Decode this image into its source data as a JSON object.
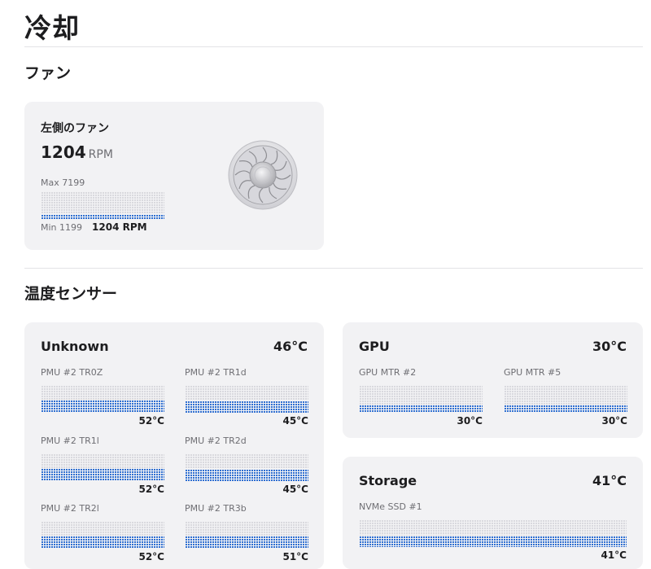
{
  "page": {
    "title": "冷却"
  },
  "fans_section": {
    "title": "ファン",
    "fan": {
      "name": "左側のファン",
      "rpm": "1204",
      "unit": "RPM",
      "max_label": "Max 7199",
      "min_label": "Min 1199",
      "current_label": "1204 RPM",
      "icon": "fan-icon"
    }
  },
  "sensors_section": {
    "title": "温度センサー",
    "groups": {
      "unknown": {
        "title": "Unknown",
        "temp": "46°C",
        "sensors": [
          {
            "label": "PMU #2 TR0Z",
            "value": "52°C",
            "fill_pct": 52
          },
          {
            "label": "PMU #2 TR1d",
            "value": "45°C",
            "fill_pct": 45
          },
          {
            "label": "PMU #2 TR1l",
            "value": "52°C",
            "fill_pct": 52
          },
          {
            "label": "PMU #2 TR2d",
            "value": "45°C",
            "fill_pct": 45
          },
          {
            "label": "PMU #2 TR2l",
            "value": "52°C",
            "fill_pct": 52
          },
          {
            "label": "PMU #2 TR3b",
            "value": "51°C",
            "fill_pct": 51
          }
        ]
      },
      "gpu": {
        "title": "GPU",
        "temp": "30°C",
        "sensors": [
          {
            "label": "GPU MTR #2",
            "value": "30°C",
            "fill_pct": 30
          },
          {
            "label": "GPU MTR #5",
            "value": "30°C",
            "fill_pct": 30
          }
        ]
      },
      "storage": {
        "title": "Storage",
        "temp": "41°C",
        "sensors": [
          {
            "label": "NVMe SSD #1",
            "value": "41°C",
            "fill_pct": 41
          }
        ]
      }
    }
  },
  "colors": {
    "bar_fill": "#2f6fd1",
    "card_bg": "#f2f2f4"
  }
}
